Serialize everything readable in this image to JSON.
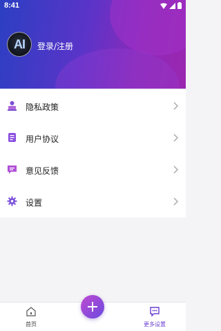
{
  "status_bar": {
    "time": "8:41"
  },
  "profile": {
    "avatar_text": "AI",
    "login_label": "登录/注册"
  },
  "menu": {
    "items": [
      {
        "label": "隐私政策",
        "icon": "privacy-policy-icon"
      },
      {
        "label": "用户协议",
        "icon": "user-agreement-icon"
      },
      {
        "label": "意见反馈",
        "icon": "feedback-icon"
      },
      {
        "label": "设置",
        "icon": "settings-icon"
      }
    ]
  },
  "bottom_nav": {
    "home_label": "首页",
    "more_label": "更多设置"
  },
  "colors": {
    "accent": "#6a3fd0",
    "header_start": "#2b3fc2",
    "header_end": "#9b26b0"
  }
}
